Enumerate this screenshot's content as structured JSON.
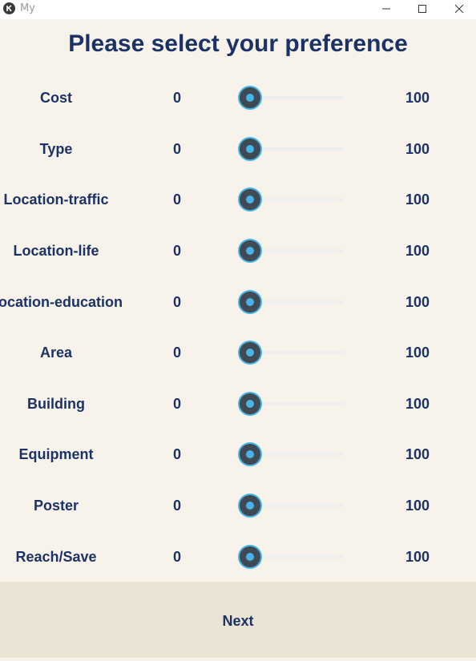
{
  "window": {
    "title": "My",
    "icon": "kivy-app-icon",
    "controls": [
      "minimize-icon",
      "maximize-icon",
      "close-icon"
    ]
  },
  "page": {
    "title": "Please select your preference"
  },
  "colors": {
    "background": "#f8f3ea",
    "text": "#1b3266",
    "accent": "#47b5e6",
    "thumb": "#3f4a55",
    "footer": "#ebe3d3"
  },
  "preferences": [
    {
      "label": "Cost",
      "min": "0",
      "max": "100",
      "value": 0
    },
    {
      "label": "Type",
      "min": "0",
      "max": "100",
      "value": 0
    },
    {
      "label": "Location-traffic",
      "min": "0",
      "max": "100",
      "value": 0
    },
    {
      "label": "Location-life",
      "min": "0",
      "max": "100",
      "value": 0
    },
    {
      "label": "Location-education",
      "min": "0",
      "max": "100",
      "value": 0
    },
    {
      "label": "Area",
      "min": "0",
      "max": "100",
      "value": 0
    },
    {
      "label": "Building",
      "min": "0",
      "max": "100",
      "value": 0
    },
    {
      "label": "Equipment",
      "min": "0",
      "max": "100",
      "value": 0
    },
    {
      "label": "Poster",
      "min": "0",
      "max": "100",
      "value": 0
    },
    {
      "label": "Reach/Save",
      "min": "0",
      "max": "100",
      "value": 0
    }
  ],
  "footer": {
    "next_label": "Next"
  }
}
